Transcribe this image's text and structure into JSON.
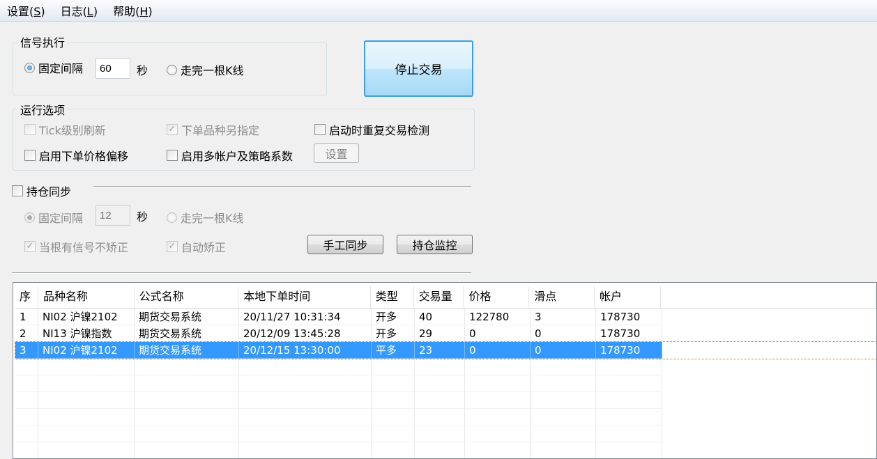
{
  "menu": [
    {
      "label": "设置(",
      "key": "S",
      "end": ")"
    },
    {
      "label": "日志(",
      "key": "L",
      "end": ")"
    },
    {
      "label": "帮助(",
      "key": "H",
      "end": ")"
    }
  ],
  "signal": {
    "title": "信号执行",
    "fixed_label": "固定间隔",
    "interval": "60",
    "sec": "秒",
    "kline_label": "走完一根K线",
    "mode": "fixed"
  },
  "stop_button": "停止交易",
  "options": {
    "title": "运行选项",
    "tick": "Tick级别刷新",
    "tick_checked": false,
    "symbol": "下单品种另指定",
    "symbol_checked": true,
    "startup": "启动时重复交易检测",
    "startup_checked": false,
    "offset": "启用下单价格偏移",
    "offset_checked": false,
    "multi": "启用多帐户及策略系数",
    "multi_checked": false,
    "settings": "设置"
  },
  "sync": {
    "title": "持仓同步",
    "checked": false,
    "fixed_label": "固定间隔",
    "interval": "12",
    "sec": "秒",
    "kline_label": "走完一根K线",
    "no_correct": "当根有信号不矫正",
    "auto_correct": "自动矫正",
    "manual": "手工同步",
    "monitor": "持仓监控"
  },
  "table": {
    "columns": [
      "序",
      "品种名称",
      "公式名称",
      "本地下单时间",
      "类型",
      "交易量",
      "价格",
      "滑点",
      "帐户"
    ],
    "rows": [
      [
        "1",
        "NI02 沪镍2102",
        "期货交易系统",
        "20/11/27 10:31:34",
        "开多",
        "40",
        "122780",
        "3",
        "178730"
      ],
      [
        "2",
        "NI13 沪镍指数",
        "期货交易系统",
        "20/12/09 13:45:28",
        "开多",
        "29",
        "0",
        "0",
        "178730"
      ],
      [
        "3",
        "NI02 沪镍2102",
        "期货交易系统",
        "20/12/15 13:30:00",
        "平多",
        "23",
        "0",
        "0",
        "178730"
      ]
    ],
    "selected_row": 2
  }
}
